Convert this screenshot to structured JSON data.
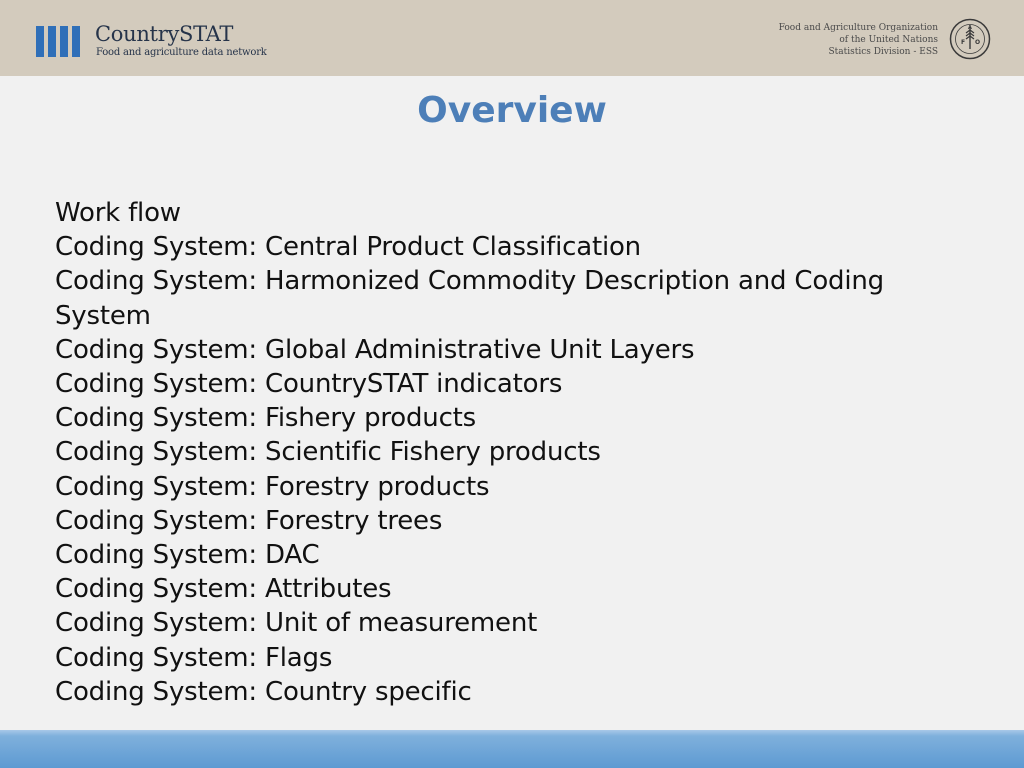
{
  "header": {
    "brand_name": "CountrySTAT",
    "brand_tagline": "Food and agriculture data network",
    "org_lines": [
      "Food and Agriculture Organization",
      "of the United Nations",
      "Statistics Division - ESS"
    ],
    "logo_icon": "countrystat-bars-logo",
    "emblem_icon": "fao-emblem",
    "emblem_text": "FIAT PANIS"
  },
  "slide": {
    "title": "Overview",
    "items": [
      "Work flow",
      "Coding System: Central Product Classification",
      "Coding System: Harmonized Commodity Description and Coding",
      "System",
      "Coding System: Global Administrative Unit Layers",
      "Coding System: CountrySTAT indicators",
      "Coding System: Fishery products",
      "Coding System: Scientific Fishery products",
      "Coding System: Forestry products",
      "Coding System: Forestry trees",
      "Coding System: DAC",
      "Coding System: Attributes",
      "Coding System: Unit of measurement",
      "Coding System: Flags",
      "Coding System: Country specific"
    ]
  },
  "colors": {
    "header_bg": "#d3cbbd",
    "brand_blue": "#2f6fb8",
    "title_blue": "#4d7fb8",
    "page_bg": "#f1f1f1",
    "footer_blue": "#5d9ad2"
  }
}
